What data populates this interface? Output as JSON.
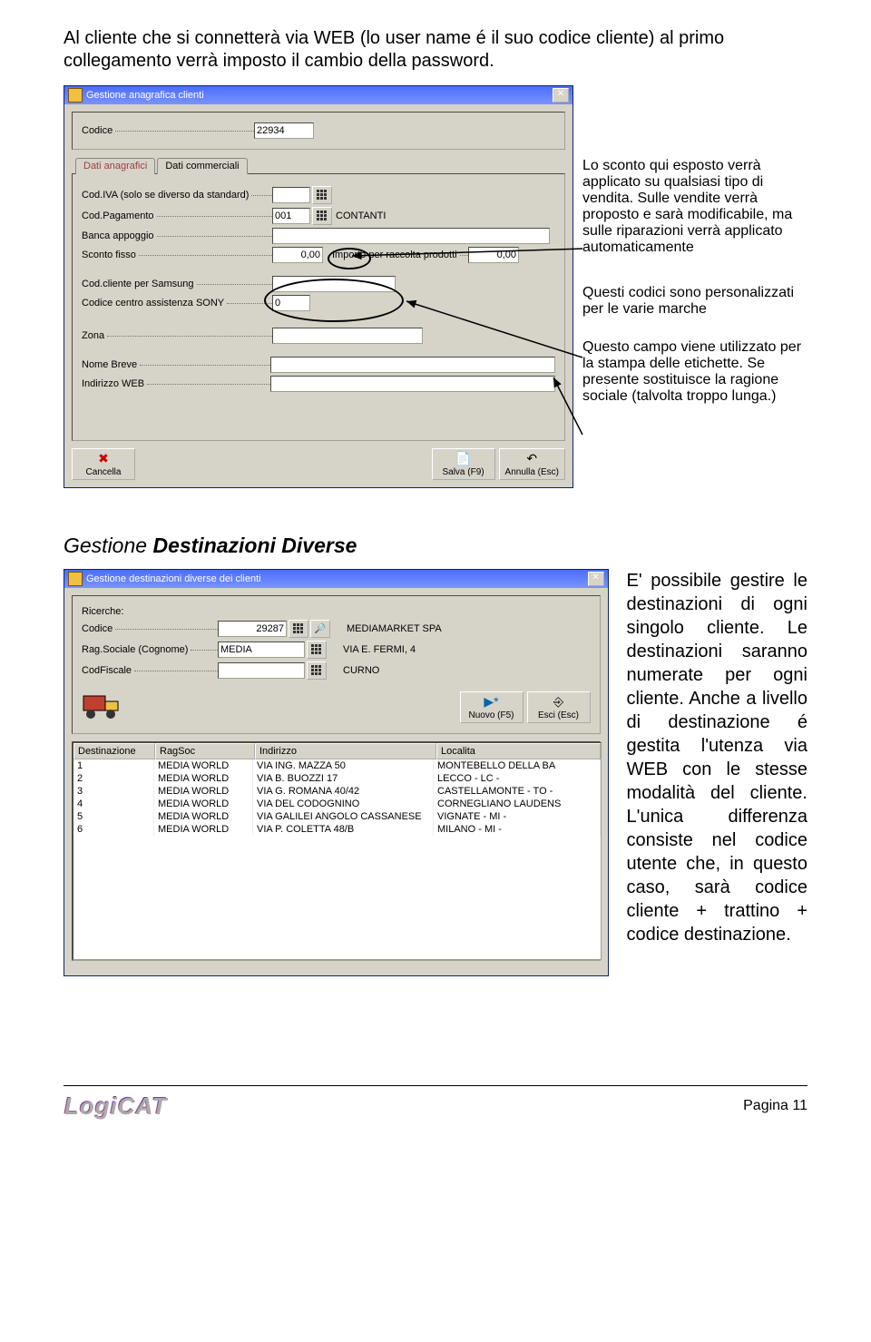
{
  "intro_paragraph": "Al cliente che si connetterà via WEB (lo user name é il suo codice cliente) al primo collegamento verrà imposto il cambio della password.",
  "window1": {
    "title": "Gestione anagrafica clienti",
    "codice_label": "Codice",
    "codice_value": "22934",
    "tabs": {
      "t1": "Dati anagrafici",
      "t2": "Dati commerciali"
    },
    "fields": {
      "cod_iva_label": "Cod.IVA (solo se diverso da standard)",
      "cod_pagamento_label": "Cod.Pagamento",
      "cod_pagamento_value": "001",
      "cod_pagamento_disp": "CONTANTI",
      "banca_label": "Banca appoggio",
      "sconto_fisso_label": "Sconto fisso",
      "sconto_fisso_value": "0,00",
      "importo_raccolta_label": "Importo per raccolta prodotti",
      "importo_raccolta_value": "0,00",
      "cod_samsung_label": "Cod.cliente per Samsung",
      "cod_sony_label": "Codice centro assistenza SONY",
      "cod_sony_value": "0",
      "zona_label": "Zona",
      "nome_breve_label": "Nome Breve",
      "indirizzo_web_label": "Indirizzo WEB"
    },
    "buttons": {
      "cancella": "Cancella",
      "salva": "Salva (F9)",
      "annulla": "Annulla (Esc)"
    }
  },
  "callout1": "Lo sconto qui esposto verrà applicato su qualsiasi tipo di vendita. Sulle vendite verrà proposto e sarà modificabile, ma sulle riparazioni verrà applicato automaticamente",
  "callout2": "Questi codici sono personalizzati per le varie marche",
  "callout3": "Questo campo viene utilizzato per la stampa delle etichette. Se presente sostituisce la ragione sociale (talvolta troppo lunga.)",
  "section2_title": "Gestione Destinazioni Diverse",
  "window2": {
    "title": "Gestione destinazioni diverse dei clienti",
    "ricerche_label": "Ricerche:",
    "codice_label": "Codice",
    "codice_value": "29287",
    "dest_name": "MEDIAMARKET SPA",
    "dest_addr": "VIA E. FERMI, 4",
    "dest_city": "CURNO",
    "ragsoc_label": "Rag.Sociale (Cognome)",
    "ragsoc_value": "MEDIA",
    "codfiscale_label": "CodFiscale",
    "buttons": {
      "nuovo": "Nuovo (F5)",
      "esci": "Esci (Esc)"
    },
    "columns": [
      "Destinazione",
      "RagSoc",
      "Indirizzo",
      "Localita"
    ],
    "rows": [
      [
        "1",
        "MEDIA WORLD",
        "VIA ING. MAZZA 50",
        "MONTEBELLO DELLA BA"
      ],
      [
        "2",
        "MEDIA WORLD",
        "VIA B. BUOZZI 17",
        "LECCO - LC -"
      ],
      [
        "3",
        "MEDIA WORLD",
        "VIA G. ROMANA 40/42",
        "CASTELLAMONTE - TO -"
      ],
      [
        "4",
        "MEDIA WORLD",
        "VIA DEL CODOGNINO",
        "CORNEGLIANO LAUDENS"
      ],
      [
        "5",
        "MEDIA WORLD",
        "VIA GALILEI ANGOLO CASSANESE",
        "VIGNATE - MI -"
      ],
      [
        "6",
        "MEDIA WORLD",
        "VIA P. COLETTA 48/B",
        "MILANO - MI -"
      ]
    ]
  },
  "side_paragraph": "E' possibile gestire le destinazioni di ogni singolo cliente. Le destinazioni saranno numerate per ogni cliente. Anche a livello di destinazione é gestita l'utenza via WEB con le stesse modalità del cliente. L'unica differenza consiste nel codice utente che, in questo caso, sarà codice cliente + trattino + codice destinazione.",
  "footer": {
    "logo": "LogiCAT",
    "page": "Pagina 11"
  }
}
